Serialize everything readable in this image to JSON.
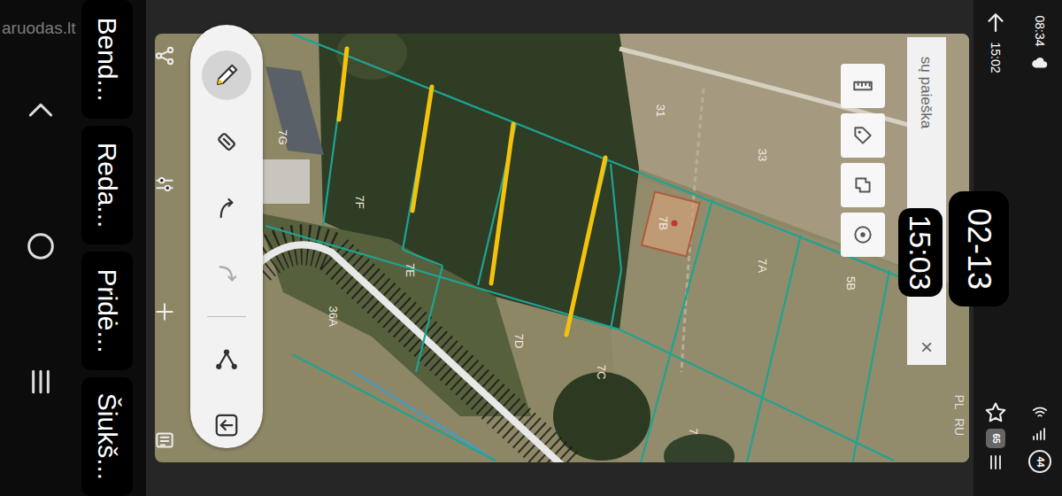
{
  "watermark": "aruodas.lt",
  "side_menu": [
    {
      "label": "Bend..."
    },
    {
      "label": "Reda..."
    },
    {
      "label": "Pridė..."
    },
    {
      "label": "Šiukš..."
    }
  ],
  "toolbar": {
    "tools": [
      {
        "kind": "pen",
        "selected": true,
        "disabled": false
      },
      {
        "kind": "eraser",
        "selected": false,
        "disabled": false
      },
      {
        "kind": "undo",
        "selected": false,
        "disabled": false
      },
      {
        "kind": "redo",
        "selected": false,
        "disabled": true
      },
      {
        "kind": "node",
        "selected": false,
        "disabled": false
      },
      {
        "kind": "back",
        "selected": false,
        "disabled": false
      }
    ]
  },
  "map": {
    "parcels": [
      {
        "label": "7G",
        "selected": false
      },
      {
        "label": "7F",
        "selected": false
      },
      {
        "label": "7E",
        "selected": false
      },
      {
        "label": "7D",
        "selected": false
      },
      {
        "label": "7C",
        "selected": false
      },
      {
        "label": "7B",
        "selected": true
      },
      {
        "label": "7A",
        "selected": false
      },
      {
        "label": "5B",
        "selected": false
      },
      {
        "label": "31",
        "selected": false
      },
      {
        "label": "33",
        "selected": false
      },
      {
        "label": "36A",
        "selected": false
      },
      {
        "label": "7",
        "selected": false
      }
    ]
  },
  "search": {
    "text": "sų paieška",
    "clear": "×"
  },
  "languages": [
    {
      "label": "PL"
    },
    {
      "label": "RU"
    }
  ],
  "time_badge": "15:03",
  "date_badge": "02-13",
  "status_bar": {
    "clock": "08:34",
    "time": "15:02",
    "badge": "65",
    "battery": "44"
  }
}
